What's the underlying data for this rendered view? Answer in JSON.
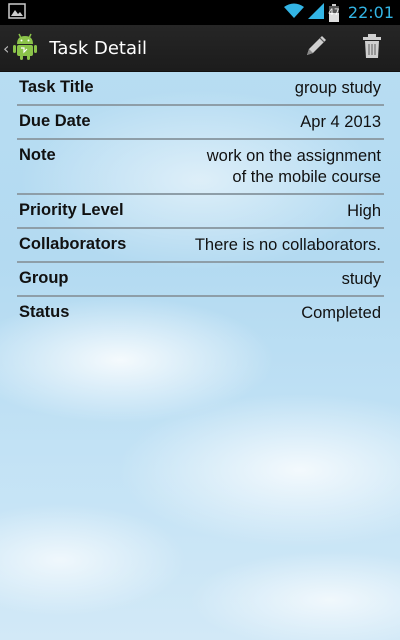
{
  "status_bar": {
    "time": "22:01",
    "battery_level": "47",
    "icons": [
      "image-notification-icon",
      "wifi-icon",
      "signal-icon",
      "battery-icon"
    ]
  },
  "action_bar": {
    "title": "Task Detail",
    "actions": [
      {
        "name": "edit",
        "icon": "pencil-icon"
      },
      {
        "name": "delete",
        "icon": "trash-icon"
      }
    ]
  },
  "details": [
    {
      "label": "Task Title",
      "value": "group study"
    },
    {
      "label": "Due Date",
      "value": "Apr 4 2013"
    },
    {
      "label": "Note",
      "value": "work on the assignment\nof the mobile course"
    },
    {
      "label": "Priority Level",
      "value": "High"
    },
    {
      "label": "Collaborators",
      "value": "There is no collaborators."
    },
    {
      "label": "Group",
      "value": "study"
    },
    {
      "label": "Status",
      "value": "Completed"
    }
  ],
  "colors": {
    "status_accent": "#33b5e5",
    "action_bar": "#1f1f1f",
    "background": "#b9def3",
    "divider": "#8e9ea8"
  }
}
